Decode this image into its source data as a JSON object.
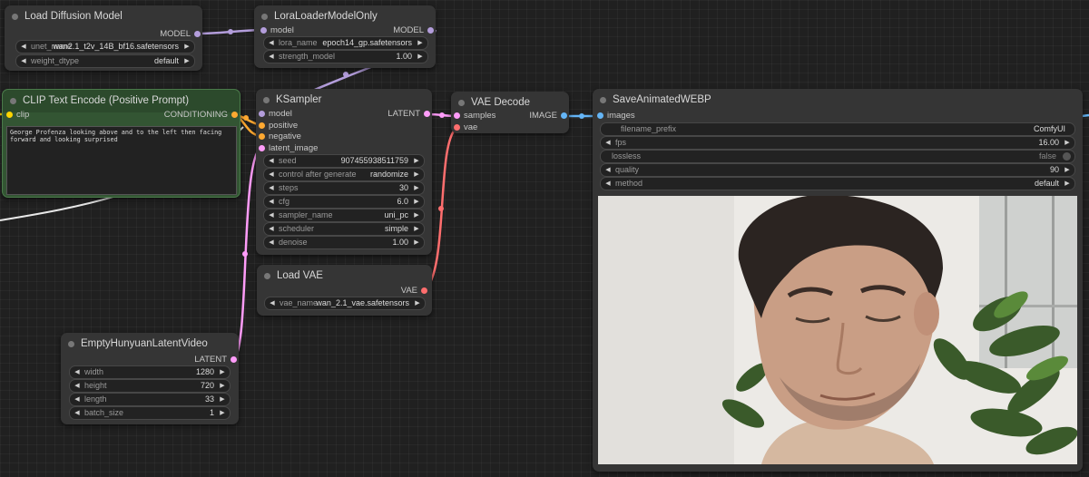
{
  "colors": {
    "model": "#b39ddb",
    "clip": "#ffd500",
    "conditioning": "#ffa931",
    "latent": "#ff9cf9",
    "vae": "#ff6e6e",
    "image": "#64b5f6"
  },
  "nodes": {
    "load_diffusion": {
      "title": "Load Diffusion Model",
      "out": "MODEL",
      "unet_name_label": "unet_name",
      "unet_name_value": "wan2.1_t2v_14B_bf16.safetensors",
      "weight_dtype_label": "weight_dtype",
      "weight_dtype_value": "default"
    },
    "lora": {
      "title": "LoraLoaderModelOnly",
      "in_model": "model",
      "out": "MODEL",
      "lora_name_label": "lora_name",
      "lora_name_value": "epoch14_gp.safetensors",
      "strength_label": "strength_model",
      "strength_value": "1.00"
    },
    "clip": {
      "title": "CLIP Text Encode (Positive Prompt)",
      "in_clip": "clip",
      "out": "CONDITIONING",
      "prompt": "George Profenza looking above and to the left then facing forward and looking surprised"
    },
    "ksampler": {
      "title": "KSampler",
      "inputs": [
        "model",
        "positive",
        "negative",
        "latent_image"
      ],
      "out": "LATENT",
      "widgets": [
        {
          "label": "seed",
          "value": "907455938511759"
        },
        {
          "label": "control after generate",
          "value": "randomize"
        },
        {
          "label": "steps",
          "value": "30"
        },
        {
          "label": "cfg",
          "value": "6.0"
        },
        {
          "label": "sampler_name",
          "value": "uni_pc"
        },
        {
          "label": "scheduler",
          "value": "simple"
        },
        {
          "label": "denoise",
          "value": "1.00"
        }
      ]
    },
    "vae_decode": {
      "title": "VAE Decode",
      "in_samples": "samples",
      "in_vae": "vae",
      "out": "IMAGE"
    },
    "load_vae": {
      "title": "Load VAE",
      "out": "VAE",
      "vae_name_label": "vae_name",
      "vae_name_value": "wan_2.1_vae.safetensors"
    },
    "latent_video": {
      "title": "EmptyHunyuanLatentVideo",
      "out": "LATENT",
      "widgets": [
        {
          "label": "width",
          "value": "1280"
        },
        {
          "label": "height",
          "value": "720"
        },
        {
          "label": "length",
          "value": "33"
        },
        {
          "label": "batch_size",
          "value": "1"
        }
      ]
    },
    "save_webp": {
      "title": "SaveAnimatedWEBP",
      "in_images": "images",
      "widgets": [
        {
          "label": "filename_prefix",
          "value": "ComfyUI"
        },
        {
          "label": "fps",
          "value": "16.00"
        },
        {
          "label": "lossless",
          "value": "false"
        },
        {
          "label": "quality",
          "value": "90"
        },
        {
          "label": "method",
          "value": "default"
        }
      ]
    }
  }
}
